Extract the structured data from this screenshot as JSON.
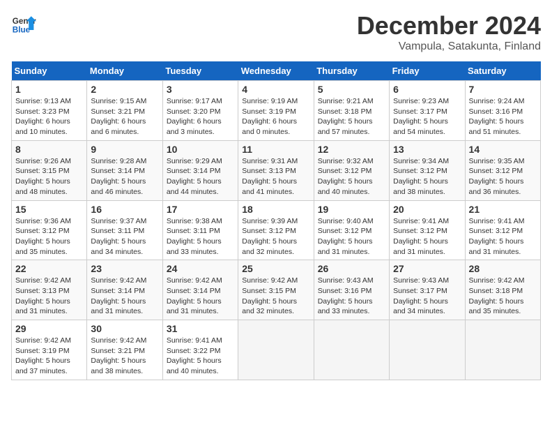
{
  "logo": {
    "line1": "General",
    "line2": "Blue"
  },
  "title": "December 2024",
  "subtitle": "Vampula, Satakunta, Finland",
  "days_of_week": [
    "Sunday",
    "Monday",
    "Tuesday",
    "Wednesday",
    "Thursday",
    "Friday",
    "Saturday"
  ],
  "weeks": [
    [
      {
        "day": "1",
        "info": "Sunrise: 9:13 AM\nSunset: 3:23 PM\nDaylight: 6 hours\nand 10 minutes."
      },
      {
        "day": "2",
        "info": "Sunrise: 9:15 AM\nSunset: 3:21 PM\nDaylight: 6 hours\nand 6 minutes."
      },
      {
        "day": "3",
        "info": "Sunrise: 9:17 AM\nSunset: 3:20 PM\nDaylight: 6 hours\nand 3 minutes."
      },
      {
        "day": "4",
        "info": "Sunrise: 9:19 AM\nSunset: 3:19 PM\nDaylight: 6 hours\nand 0 minutes."
      },
      {
        "day": "5",
        "info": "Sunrise: 9:21 AM\nSunset: 3:18 PM\nDaylight: 5 hours\nand 57 minutes."
      },
      {
        "day": "6",
        "info": "Sunrise: 9:23 AM\nSunset: 3:17 PM\nDaylight: 5 hours\nand 54 minutes."
      },
      {
        "day": "7",
        "info": "Sunrise: 9:24 AM\nSunset: 3:16 PM\nDaylight: 5 hours\nand 51 minutes."
      }
    ],
    [
      {
        "day": "8",
        "info": "Sunrise: 9:26 AM\nSunset: 3:15 PM\nDaylight: 5 hours\nand 48 minutes."
      },
      {
        "day": "9",
        "info": "Sunrise: 9:28 AM\nSunset: 3:14 PM\nDaylight: 5 hours\nand 46 minutes."
      },
      {
        "day": "10",
        "info": "Sunrise: 9:29 AM\nSunset: 3:14 PM\nDaylight: 5 hours\nand 44 minutes."
      },
      {
        "day": "11",
        "info": "Sunrise: 9:31 AM\nSunset: 3:13 PM\nDaylight: 5 hours\nand 41 minutes."
      },
      {
        "day": "12",
        "info": "Sunrise: 9:32 AM\nSunset: 3:12 PM\nDaylight: 5 hours\nand 40 minutes."
      },
      {
        "day": "13",
        "info": "Sunrise: 9:34 AM\nSunset: 3:12 PM\nDaylight: 5 hours\nand 38 minutes."
      },
      {
        "day": "14",
        "info": "Sunrise: 9:35 AM\nSunset: 3:12 PM\nDaylight: 5 hours\nand 36 minutes."
      }
    ],
    [
      {
        "day": "15",
        "info": "Sunrise: 9:36 AM\nSunset: 3:12 PM\nDaylight: 5 hours\nand 35 minutes."
      },
      {
        "day": "16",
        "info": "Sunrise: 9:37 AM\nSunset: 3:11 PM\nDaylight: 5 hours\nand 34 minutes."
      },
      {
        "day": "17",
        "info": "Sunrise: 9:38 AM\nSunset: 3:11 PM\nDaylight: 5 hours\nand 33 minutes."
      },
      {
        "day": "18",
        "info": "Sunrise: 9:39 AM\nSunset: 3:12 PM\nDaylight: 5 hours\nand 32 minutes."
      },
      {
        "day": "19",
        "info": "Sunrise: 9:40 AM\nSunset: 3:12 PM\nDaylight: 5 hours\nand 31 minutes."
      },
      {
        "day": "20",
        "info": "Sunrise: 9:41 AM\nSunset: 3:12 PM\nDaylight: 5 hours\nand 31 minutes."
      },
      {
        "day": "21",
        "info": "Sunrise: 9:41 AM\nSunset: 3:12 PM\nDaylight: 5 hours\nand 31 minutes."
      }
    ],
    [
      {
        "day": "22",
        "info": "Sunrise: 9:42 AM\nSunset: 3:13 PM\nDaylight: 5 hours\nand 31 minutes."
      },
      {
        "day": "23",
        "info": "Sunrise: 9:42 AM\nSunset: 3:14 PM\nDaylight: 5 hours\nand 31 minutes."
      },
      {
        "day": "24",
        "info": "Sunrise: 9:42 AM\nSunset: 3:14 PM\nDaylight: 5 hours\nand 31 minutes."
      },
      {
        "day": "25",
        "info": "Sunrise: 9:42 AM\nSunset: 3:15 PM\nDaylight: 5 hours\nand 32 minutes."
      },
      {
        "day": "26",
        "info": "Sunrise: 9:43 AM\nSunset: 3:16 PM\nDaylight: 5 hours\nand 33 minutes."
      },
      {
        "day": "27",
        "info": "Sunrise: 9:43 AM\nSunset: 3:17 PM\nDaylight: 5 hours\nand 34 minutes."
      },
      {
        "day": "28",
        "info": "Sunrise: 9:42 AM\nSunset: 3:18 PM\nDaylight: 5 hours\nand 35 minutes."
      }
    ],
    [
      {
        "day": "29",
        "info": "Sunrise: 9:42 AM\nSunset: 3:19 PM\nDaylight: 5 hours\nand 37 minutes."
      },
      {
        "day": "30",
        "info": "Sunrise: 9:42 AM\nSunset: 3:21 PM\nDaylight: 5 hours\nand 38 minutes."
      },
      {
        "day": "31",
        "info": "Sunrise: 9:41 AM\nSunset: 3:22 PM\nDaylight: 5 hours\nand 40 minutes."
      },
      null,
      null,
      null,
      null
    ]
  ]
}
